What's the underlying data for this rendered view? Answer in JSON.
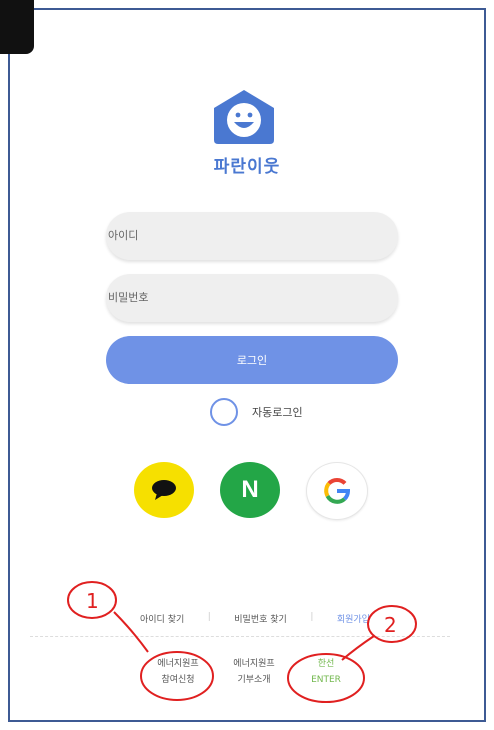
{
  "brand": {
    "name": "파란이웃"
  },
  "login": {
    "id_placeholder": "아이디",
    "password_placeholder": "비밀번호",
    "login_label": "로그인",
    "auto_login_label": "자동로그인"
  },
  "social": {
    "kakao_icon": "chat-bubble-icon",
    "naver_label": "N",
    "google_label": "G"
  },
  "links": {
    "find_id": "아이디 찾기",
    "find_password": "비밀번호 찾기",
    "signup": "회원가입"
  },
  "footer": {
    "item1_line1": "에너지원프",
    "item1_line2": "참여신청",
    "item2_line1": "에너지원프",
    "item2_line2": "기부소개",
    "item3_line1": "한선",
    "item3_line2": "ENTER"
  },
  "annotations": {
    "mark1": "1",
    "mark2": "2"
  },
  "colors": {
    "primary": "#6f92e6",
    "kakao": "#f6e000",
    "naver": "#23a647"
  }
}
